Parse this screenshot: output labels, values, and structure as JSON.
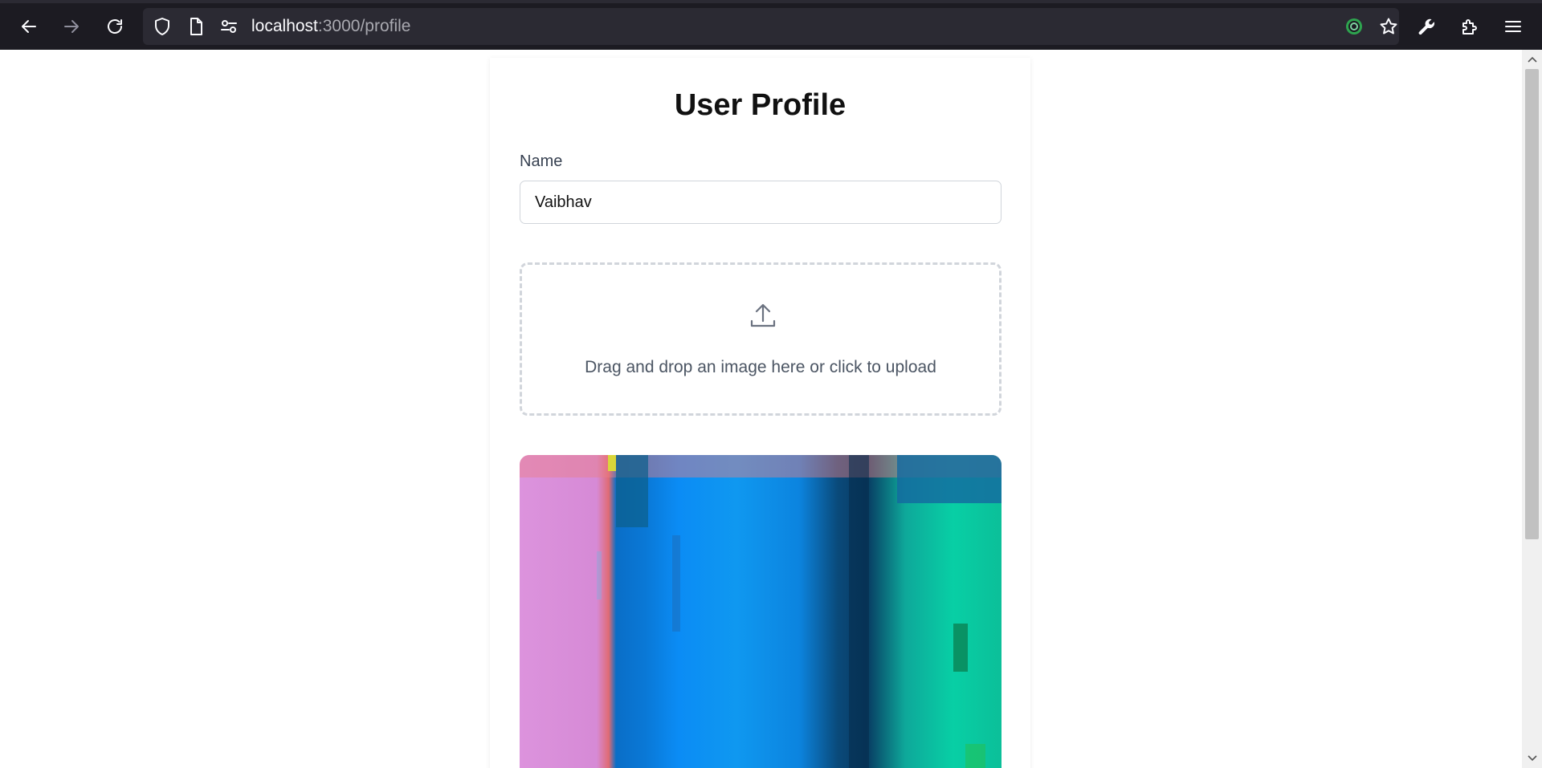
{
  "browser": {
    "url_host": "localhost",
    "url_path": ":3000/profile",
    "icons": [
      "back-arrow-icon",
      "forward-arrow-icon",
      "reload-icon",
      "shield-icon",
      "page-icon",
      "site-permissions-icon",
      "extension-badge-icon",
      "bookmark-star-icon",
      "wrench-icon",
      "extensions-icon",
      "menu-icon"
    ]
  },
  "page": {
    "title": "User Profile",
    "name_label": "Name",
    "name_value": "Vaibhav",
    "dropzone_text": "Drag and drop an image here or click to upload",
    "upload_icon": "upload-icon",
    "preview_image": "uploaded-image-preview"
  },
  "colors": {
    "toolbar_bg": "#1c1b22",
    "urlbar_bg": "#2b2a33",
    "text_dark": "#111111",
    "text_muted": "#4b5563",
    "border": "#d1d5db"
  }
}
